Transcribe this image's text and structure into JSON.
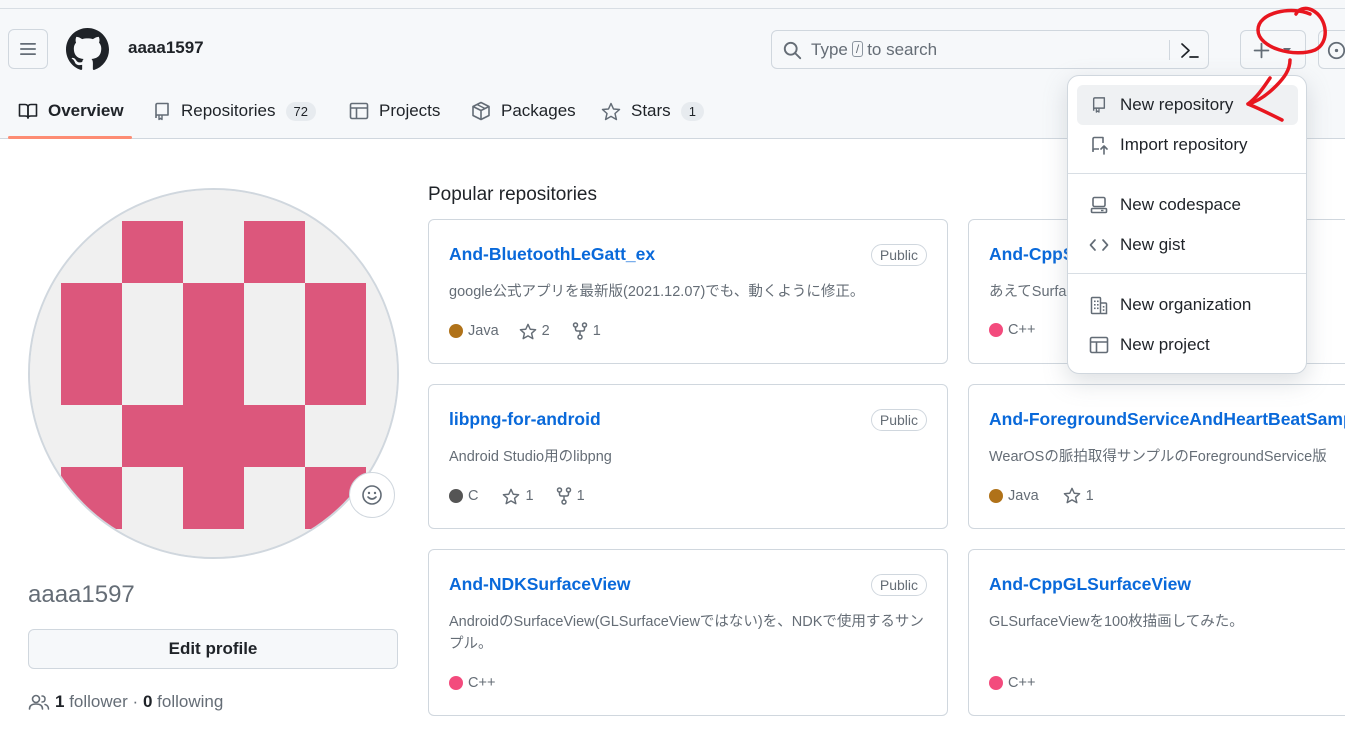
{
  "header": {
    "username": "aaaa1597",
    "search_placeholder_prefix": "Type",
    "search_key_hint": "/",
    "search_placeholder_suffix": "to search"
  },
  "tabs": [
    {
      "label": "Overview",
      "icon": "book-icon"
    },
    {
      "label": "Repositories",
      "icon": "repo-icon",
      "count": "72"
    },
    {
      "label": "Projects",
      "icon": "table-icon"
    },
    {
      "label": "Packages",
      "icon": "package-icon"
    },
    {
      "label": "Stars",
      "icon": "star-icon",
      "count": "1"
    }
  ],
  "profile": {
    "login": "aaaa1597",
    "edit_label": "Edit profile",
    "followers_count": "1",
    "followers_label": "follower",
    "separator": "·",
    "following_count": "0",
    "following_label": "following"
  },
  "popular": {
    "title": "Popular repositories",
    "repos": [
      {
        "name": "And-BluetoothLeGatt_ex",
        "visibility": "Public",
        "description": "google公式アプリを最新版(2021.12.07)でも、動くように修正。",
        "language": "Java",
        "lang_color": "#b07219",
        "stars": "2",
        "forks": "1"
      },
      {
        "name": "And-CppS",
        "description": "あえてSurfa",
        "language": "C++",
        "lang_color": "#f34b7d"
      },
      {
        "name": "libpng-for-android",
        "visibility": "Public",
        "description": "Android Studio用のlibpng",
        "language": "C",
        "lang_color": "#555555",
        "stars": "1",
        "forks": "1"
      },
      {
        "name": "And-ForegroundServiceAndHeartBeatSample",
        "description": "WearOSの脈拍取得サンプルのForegroundService版",
        "language": "Java",
        "lang_color": "#b07219",
        "stars": "1"
      },
      {
        "name": "And-NDKSurfaceView",
        "visibility": "Public",
        "description": "AndroidのSurfaceView(GLSurfaceViewではない)を、NDKで使用するサンプル。",
        "language": "C++",
        "lang_color": "#f34b7d"
      },
      {
        "name": "And-CppGLSurfaceView",
        "description": "GLSurfaceViewを100枚描画してみた。",
        "language": "C++",
        "lang_color": "#f34b7d"
      }
    ]
  },
  "create_menu": {
    "items": [
      {
        "label": "New repository",
        "icon": "repo-icon"
      },
      {
        "label": "Import repository",
        "icon": "repo-push-icon"
      },
      {
        "label": "New codespace",
        "icon": "codespaces-icon"
      },
      {
        "label": "New gist",
        "icon": "code-icon"
      },
      {
        "label": "New organization",
        "icon": "organization-icon"
      },
      {
        "label": "New project",
        "icon": "table-icon"
      }
    ]
  },
  "colors": {
    "link": "#0969da",
    "avatar_pink": "#dc577c",
    "tab_underline": "#fd8c73",
    "annotation_red": "#e8161f"
  }
}
